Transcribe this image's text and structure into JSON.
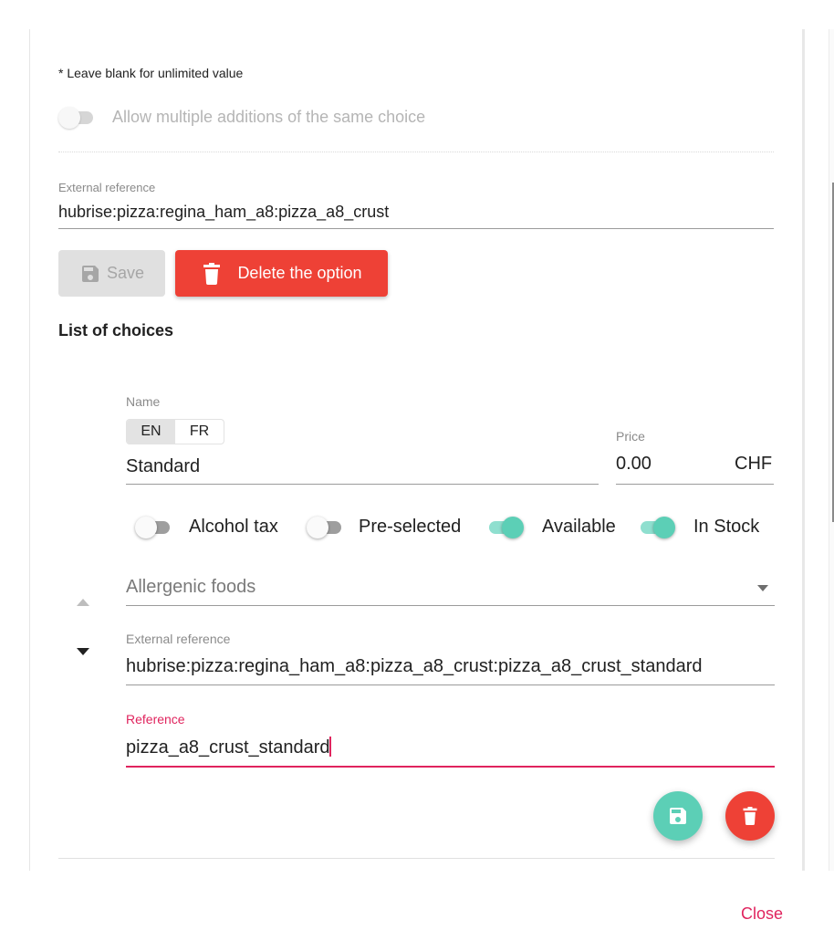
{
  "colors": {
    "accent_teal": "#5ccfb6",
    "danger_red": "#ee4136",
    "focus_pink": "#e0245e"
  },
  "option": {
    "hint": "* Leave blank for unlimited value",
    "allow_multiple": {
      "label": "Allow multiple additions of the same choice",
      "checked": false,
      "disabled": true
    },
    "external_reference": {
      "label": "External reference",
      "value": "hubrise:pizza:regina_ham_a8:pizza_a8_crust"
    },
    "save_label": "Save",
    "delete_label": "Delete the option"
  },
  "choices": {
    "title": "List of choices",
    "items": [
      {
        "name_label": "Name",
        "languages": [
          "EN",
          "FR"
        ],
        "active_language": "EN",
        "name_value": "Standard",
        "price_label": "Price",
        "price_value": "0.00",
        "currency": "CHF",
        "toggles": [
          {
            "label": "Alcohol tax",
            "checked": false
          },
          {
            "label": "Pre-selected",
            "checked": false
          },
          {
            "label": "Available",
            "checked": true
          },
          {
            "label": "In Stock",
            "checked": true
          }
        ],
        "allergens_placeholder": "Allergenic foods",
        "external_reference": {
          "label": "External reference",
          "value": "hubrise:pizza:regina_ham_a8:pizza_a8_crust:pizza_a8_crust_standard"
        },
        "reference": {
          "label": "Reference",
          "value": "pizza_a8_crust_standard"
        }
      }
    ]
  },
  "footer": {
    "close_label": "Close"
  }
}
